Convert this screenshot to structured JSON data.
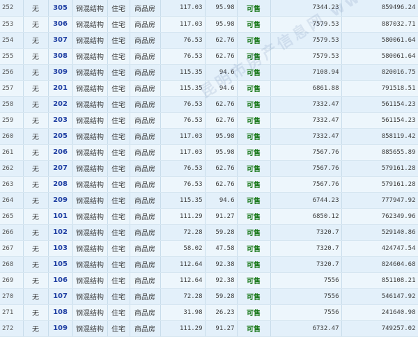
{
  "rows": [
    {
      "idx": "252",
      "mark": "无",
      "room": "305",
      "struct": "钢混结构",
      "use": "住宅",
      "type": "商品房",
      "area": "117.03",
      "inner": "95.98",
      "status": "可售",
      "price": "7344.23",
      "total": "859496.24"
    },
    {
      "idx": "253",
      "mark": "无",
      "room": "306",
      "struct": "钢混结构",
      "use": "住宅",
      "type": "商品房",
      "area": "117.03",
      "inner": "95.98",
      "status": "可售",
      "price": "7579.53",
      "total": "887032.71"
    },
    {
      "idx": "254",
      "mark": "无",
      "room": "307",
      "struct": "钢混结构",
      "use": "住宅",
      "type": "商品房",
      "area": "76.53",
      "inner": "62.76",
      "status": "可售",
      "price": "7579.53",
      "total": "580061.64"
    },
    {
      "idx": "255",
      "mark": "无",
      "room": "308",
      "struct": "钢混结构",
      "use": "住宅",
      "type": "商品房",
      "area": "76.53",
      "inner": "62.76",
      "status": "可售",
      "price": "7579.53",
      "total": "580061.64"
    },
    {
      "idx": "256",
      "mark": "无",
      "room": "309",
      "struct": "钢混结构",
      "use": "住宅",
      "type": "商品房",
      "area": "115.35",
      "inner": "94.6",
      "status": "可售",
      "price": "7108.94",
      "total": "820016.75"
    },
    {
      "idx": "257",
      "mark": "无",
      "room": "201",
      "struct": "钢混结构",
      "use": "住宅",
      "type": "商品房",
      "area": "115.35",
      "inner": "94.6",
      "status": "可售",
      "price": "6861.88",
      "total": "791518.51"
    },
    {
      "idx": "258",
      "mark": "无",
      "room": "202",
      "struct": "钢混结构",
      "use": "住宅",
      "type": "商品房",
      "area": "76.53",
      "inner": "62.76",
      "status": "可售",
      "price": "7332.47",
      "total": "561154.23"
    },
    {
      "idx": "259",
      "mark": "无",
      "room": "203",
      "struct": "钢混结构",
      "use": "住宅",
      "type": "商品房",
      "area": "76.53",
      "inner": "62.76",
      "status": "可售",
      "price": "7332.47",
      "total": "561154.23"
    },
    {
      "idx": "260",
      "mark": "无",
      "room": "205",
      "struct": "钢混结构",
      "use": "住宅",
      "type": "商品房",
      "area": "117.03",
      "inner": "95.98",
      "status": "可售",
      "price": "7332.47",
      "total": "858119.42"
    },
    {
      "idx": "261",
      "mark": "无",
      "room": "206",
      "struct": "钢混结构",
      "use": "住宅",
      "type": "商品房",
      "area": "117.03",
      "inner": "95.98",
      "status": "可售",
      "price": "7567.76",
      "total": "885655.89"
    },
    {
      "idx": "262",
      "mark": "无",
      "room": "207",
      "struct": "钢混结构",
      "use": "住宅",
      "type": "商品房",
      "area": "76.53",
      "inner": "62.76",
      "status": "可售",
      "price": "7567.76",
      "total": "579161.28"
    },
    {
      "idx": "263",
      "mark": "无",
      "room": "208",
      "struct": "钢混结构",
      "use": "住宅",
      "type": "商品房",
      "area": "76.53",
      "inner": "62.76",
      "status": "可售",
      "price": "7567.76",
      "total": "579161.28"
    },
    {
      "idx": "264",
      "mark": "无",
      "room": "209",
      "struct": "钢混结构",
      "use": "住宅",
      "type": "商品房",
      "area": "115.35",
      "inner": "94.6",
      "status": "可售",
      "price": "6744.23",
      "total": "777947.92"
    },
    {
      "idx": "265",
      "mark": "无",
      "room": "101",
      "struct": "钢混结构",
      "use": "住宅",
      "type": "商品房",
      "area": "111.29",
      "inner": "91.27",
      "status": "可售",
      "price": "6850.12",
      "total": "762349.96"
    },
    {
      "idx": "266",
      "mark": "无",
      "room": "102",
      "struct": "钢混结构",
      "use": "住宅",
      "type": "商品房",
      "area": "72.28",
      "inner": "59.28",
      "status": "可售",
      "price": "7320.7",
      "total": "529140.86"
    },
    {
      "idx": "267",
      "mark": "无",
      "room": "103",
      "struct": "钢混结构",
      "use": "住宅",
      "type": "商品房",
      "area": "58.02",
      "inner": "47.58",
      "status": "可售",
      "price": "7320.7",
      "total": "424747.54"
    },
    {
      "idx": "268",
      "mark": "无",
      "room": "105",
      "struct": "钢混结构",
      "use": "住宅",
      "type": "商品房",
      "area": "112.64",
      "inner": "92.38",
      "status": "可售",
      "price": "7320.7",
      "total": "824604.68"
    },
    {
      "idx": "269",
      "mark": "无",
      "room": "106",
      "struct": "钢混结构",
      "use": "住宅",
      "type": "商品房",
      "area": "112.64",
      "inner": "92.38",
      "status": "可售",
      "price": "7556",
      "total": "851108.21"
    },
    {
      "idx": "270",
      "mark": "无",
      "room": "107",
      "struct": "钢混结构",
      "use": "住宅",
      "type": "商品房",
      "area": "72.28",
      "inner": "59.28",
      "status": "可售",
      "price": "7556",
      "total": "546147.92"
    },
    {
      "idx": "271",
      "mark": "无",
      "room": "108",
      "struct": "钢混结构",
      "use": "住宅",
      "type": "商品房",
      "area": "31.98",
      "inner": "26.23",
      "status": "可售",
      "price": "7556",
      "total": "241640.98"
    },
    {
      "idx": "272",
      "mark": "无",
      "room": "109",
      "struct": "钢混结构",
      "use": "住宅",
      "type": "商品房",
      "area": "111.29",
      "inner": "91.27",
      "status": "可售",
      "price": "6732.47",
      "total": "749257.02"
    }
  ],
  "watermark": "昆明市房产信息网 www.kmhouse.org"
}
